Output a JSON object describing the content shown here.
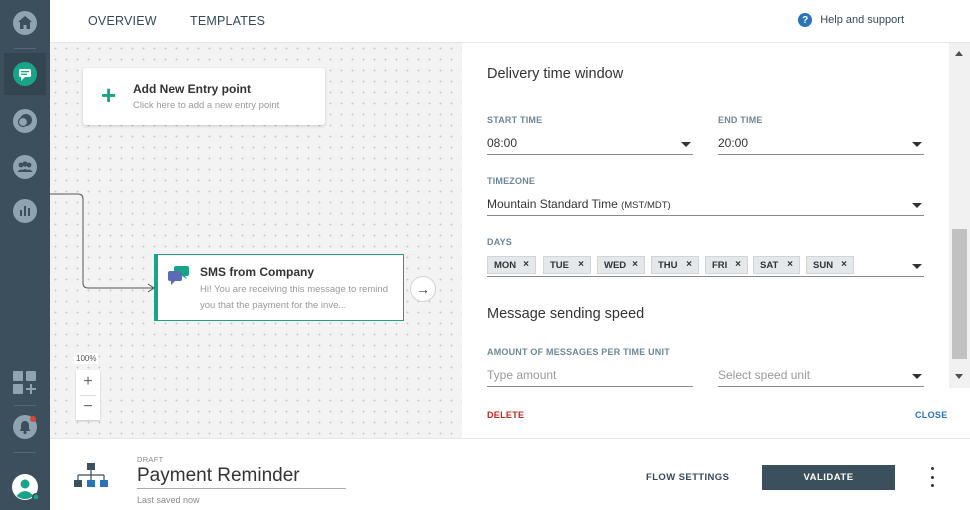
{
  "rail": {
    "items": [
      {
        "icon": "home-icon"
      },
      {
        "icon": "flows-icon",
        "active": true
      },
      {
        "icon": "conversations-icon"
      },
      {
        "icon": "people-icon"
      },
      {
        "icon": "analytics-icon"
      },
      {
        "icon": "apps-add-icon"
      },
      {
        "icon": "notifications-icon"
      },
      {
        "icon": "user-avatar-icon"
      }
    ]
  },
  "header": {
    "tabs": [
      {
        "label": "OVERVIEW"
      },
      {
        "label": "TEMPLATES"
      }
    ],
    "help_label": "Help and support",
    "help_glyph": "?"
  },
  "canvas": {
    "entry": {
      "plus": "+",
      "title": "Add New Entry point",
      "subtitle": "Click here to add a new entry point"
    },
    "sms_node": {
      "title": "SMS from Company",
      "preview": "Hi! You are receiving this message to remind you that the payment for the inve..."
    },
    "connector_glyph": "→",
    "zoom": {
      "level": "100%",
      "plus": "+",
      "minus": "−"
    }
  },
  "panel": {
    "delivery_title": "Delivery time window",
    "start_time": {
      "label": "START TIME",
      "value": "08:00"
    },
    "end_time": {
      "label": "END TIME",
      "value": "20:00"
    },
    "timezone": {
      "label": "TIMEZONE",
      "value": "Mountain Standard Time",
      "suffix": "(MST/MDT)"
    },
    "days": {
      "label": "DAYS",
      "chips": [
        "MON",
        "TUE",
        "WED",
        "THU",
        "FRI",
        "SAT",
        "SUN"
      ],
      "remove_glyph": "×"
    },
    "speed_title": "Message sending speed",
    "amount": {
      "label": "AMOUNT OF MESSAGES PER TIME UNIT",
      "placeholder": "Type amount"
    },
    "speed_unit": {
      "placeholder": "Select speed unit"
    },
    "delete_label": "DELETE",
    "close_label": "CLOSE"
  },
  "footer": {
    "status": "DRAFT",
    "flow_name": "Payment Reminder",
    "saved_text": "Last saved now",
    "flow_settings_label": "FLOW SETTINGS",
    "validate_label": "VALIDATE"
  },
  "colors": {
    "rail": "#3c4f5d",
    "accent_green": "#19a387",
    "link_blue": "#2a73b8",
    "delete_red": "#c6261e"
  }
}
